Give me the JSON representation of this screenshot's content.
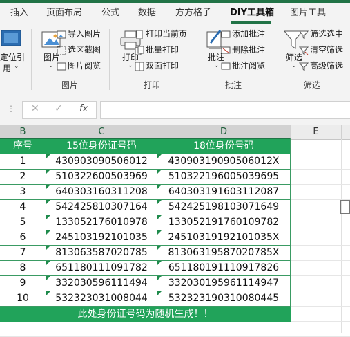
{
  "tabs": [
    "插入",
    "页面布局",
    "公式",
    "数据",
    "方方格子",
    "DIY工具箱",
    "图片工具"
  ],
  "active_tab": "DIY工具箱",
  "ribbon": {
    "locate": {
      "line1": "定位引",
      "line2": "用"
    },
    "picture_group": {
      "big_label": "图片",
      "items": [
        "导入图片",
        "选区截图",
        "图片阅览"
      ],
      "group_label": "图片"
    },
    "print_group": {
      "big_label": "打印",
      "items": [
        "打印当前页",
        "批量打印",
        "双面打印"
      ],
      "group_label": "打印"
    },
    "comment_group": {
      "big_label": "批注",
      "items": [
        "添加批注",
        "删除批注",
        "批注阅览"
      ],
      "group_label": "批注"
    },
    "filter_group": {
      "big_label": "筛选",
      "items": [
        "筛选选中",
        "清空筛选",
        "高级筛选"
      ],
      "group_label": "筛选"
    }
  },
  "formula_bar": {
    "cancel": "✕",
    "enter": "✓",
    "fx": "fx",
    "value": ""
  },
  "columns": [
    "B",
    "C",
    "D",
    "E"
  ],
  "table": {
    "headers": [
      "序号",
      "15位身份证号码",
      "18位身份号码"
    ],
    "rows": [
      [
        "1",
        "430903090506012",
        "43090319090506012X"
      ],
      [
        "2",
        "510322600503969",
        "510322196005039695"
      ],
      [
        "3",
        "640303160311208",
        "640303191603112087"
      ],
      [
        "4",
        "542425810307164",
        "542425198103071649"
      ],
      [
        "5",
        "133052176010978",
        "133052191760109782"
      ],
      [
        "6",
        "245103192101035",
        "24510319192101035X"
      ],
      [
        "7",
        "813063587020785",
        "81306319587020785X"
      ],
      [
        "8",
        "651180111091782",
        "651180191110917826"
      ],
      [
        "9",
        "332030596111494",
        "332030195961114947"
      ],
      [
        "10",
        "532323031008044",
        "532323190310080445"
      ]
    ],
    "footer": "此处身份证号码为随机生成！！"
  },
  "colors": {
    "accent": "#217346",
    "header_fill": "#21a35a"
  }
}
